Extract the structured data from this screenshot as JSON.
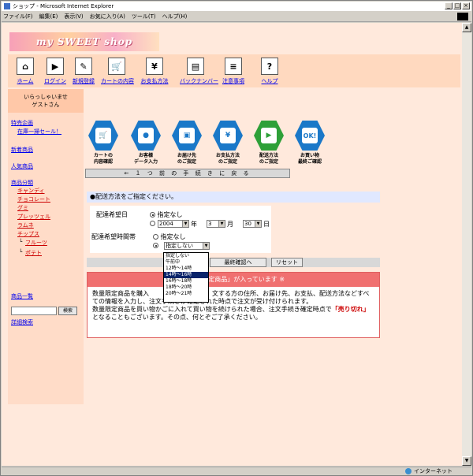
{
  "window": {
    "title": "ショップ - Microsoft Internet Explorer",
    "menu": [
      "ファイル(F)",
      "編集(E)",
      "表示(V)",
      "お気に入り(A)",
      "ツール(T)",
      "ヘルプ(H)"
    ]
  },
  "logo_text": "my SWEET shop",
  "nav": [
    {
      "label": "ホーム",
      "icon": "home-icon",
      "glyph": "⌂"
    },
    {
      "label": "ログイン",
      "icon": "login-icon",
      "glyph": "▶"
    },
    {
      "label": "新規登録",
      "icon": "register-icon",
      "glyph": "✎"
    },
    {
      "label": "カートの内容",
      "icon": "cart-icon",
      "glyph": "🛒"
    },
    {
      "label": "お支払方法",
      "icon": "payment-icon",
      "glyph": "¥"
    },
    {
      "label": "バックナンバー",
      "icon": "magazine-icon",
      "glyph": "▤"
    },
    {
      "label": "注意事項",
      "icon": "document-icon",
      "glyph": "≡"
    },
    {
      "label": "ヘルプ",
      "icon": "help-icon",
      "glyph": "?"
    }
  ],
  "sidebar": {
    "welcome_line1": "いらっしゃいませ",
    "welcome_line2": "ゲストさん",
    "special": "特売企画",
    "special_sub": "在庫一掃セール！",
    "new_items": "新着商品",
    "popular": "人気商品",
    "category": "商品分類",
    "cat_items": [
      "キャンディ",
      "チョコレート",
      "グミ",
      "プレッツェル",
      "ラムネ",
      "チップス"
    ],
    "cat_sub": [
      "フルーツ",
      "ポテト"
    ],
    "list": "商品一覧",
    "search_button": "検索",
    "advanced_search": "詳細検索"
  },
  "steps": [
    {
      "l1": "カートの",
      "l2": "内容確認",
      "icon": "cart-icon",
      "glyph": "🛒",
      "green": false
    },
    {
      "l1": "お客様",
      "l2": "データ入力",
      "icon": "person-icon",
      "glyph": "●",
      "green": false
    },
    {
      "l1": "お届け先",
      "l2": "のご指定",
      "icon": "box-icon",
      "glyph": "▣",
      "green": false
    },
    {
      "l1": "お支払方法",
      "l2": "のご指定",
      "icon": "card-icon",
      "glyph": "¥",
      "green": false
    },
    {
      "l1": "配送方法",
      "l2": "のご指定",
      "icon": "truck-icon",
      "glyph": "▶",
      "green": true
    },
    {
      "l1": "お買い物",
      "l2": "最終ご確認",
      "icon": "ok-icon",
      "glyph": "OK!",
      "green": false
    }
  ],
  "back_button": "← １ つ 前 の 手 続 き に 戻 る",
  "section_title": "●配送方法をご指定ください。",
  "form": {
    "date_label": "配達希望日",
    "opt_none": "指定なし",
    "year": "2004",
    "year_unit": "年",
    "month": "3",
    "month_unit": "月",
    "day": "30",
    "day_unit": "日",
    "time_label": "配達希望時間帯",
    "time_none": "指定なし",
    "time_selected": "指定しない",
    "confirm_button": "最終確認へ",
    "reset_button": "リセット"
  },
  "notice": {
    "header": "※ 数量限定商品」が入っています ※",
    "body1": "数量限定商品を購入　　　　　　　　　　文する方の住所、お届け先、お支払、配送方法などすべての情報を入力し、注文手続きが確定された時点で注文が受け付けられます。",
    "body2": "数量限定商品を買い物かごに入れて買い物を続けられた場合、注文手続き確定時点で",
    "sold_out": "「売り切れ」",
    "body3": "となることもございます。その点、何とぞご了承ください。"
  },
  "dropdown_options": [
    "指定しない",
    "午前中",
    "12時〜14時",
    "14時〜16時",
    "16時〜18時",
    "18時〜20時",
    "20時〜21時"
  ],
  "dropdown_highlight_index": 3,
  "status": {
    "zone": "インターネット"
  }
}
